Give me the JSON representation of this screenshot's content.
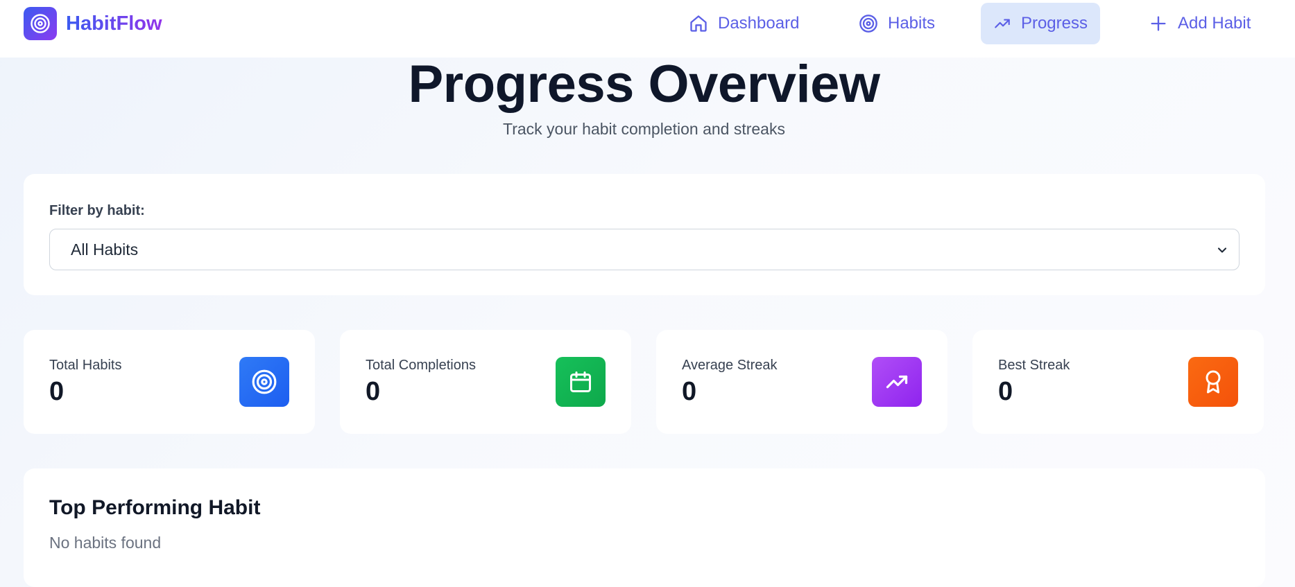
{
  "brand": {
    "name": "HabitFlow",
    "logo_icon": "target-icon"
  },
  "nav": {
    "items": [
      {
        "label": "Dashboard",
        "icon": "home-icon",
        "active": false
      },
      {
        "label": "Habits",
        "icon": "target-icon",
        "active": false
      },
      {
        "label": "Progress",
        "icon": "trending-up-icon",
        "active": true
      },
      {
        "label": "Add Habit",
        "icon": "plus-icon",
        "active": false
      }
    ]
  },
  "page": {
    "title": "Progress Overview",
    "subtitle": "Track your habit completion and streaks"
  },
  "filter": {
    "label": "Filter by habit:",
    "selected": "All Habits"
  },
  "stats": [
    {
      "label": "Total Habits",
      "value": "0",
      "icon": "target-icon",
      "color": "#2563eb"
    },
    {
      "label": "Total Completions",
      "value": "0",
      "icon": "calendar-icon",
      "color": "#16a34a"
    },
    {
      "label": "Average Streak",
      "value": "0",
      "icon": "trending-up-icon",
      "color": "#9333ea"
    },
    {
      "label": "Best Streak",
      "value": "0",
      "icon": "award-icon",
      "color": "#f4520a"
    }
  ],
  "top_performing": {
    "title": "Top Performing Habit",
    "empty_text": "No habits found"
  }
}
